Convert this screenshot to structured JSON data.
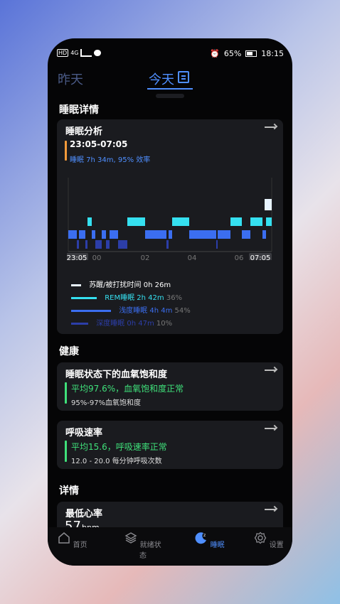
{
  "status": {
    "network": "4G",
    "battery": "65%",
    "time": "18:15",
    "hd": "HD"
  },
  "topnav": {
    "yesterday": "昨天",
    "today": "今天"
  },
  "sections": {
    "details": "睡眠详情",
    "health": "健康",
    "more": "详情"
  },
  "sleep_card": {
    "title": "睡眠分析",
    "range": "23:05-07:05",
    "summary": "睡眠 7h 34m, 95% 效率",
    "x_labels": [
      "23:05",
      "00",
      "02",
      "04",
      "06",
      "07:05"
    ]
  },
  "legend": [
    {
      "label": "苏醒/被打扰时间",
      "value": "0h 26m",
      "pct": "",
      "color": "#e8f4ff"
    },
    {
      "label": "REM睡眠",
      "value": "2h 42m",
      "pct": "36%",
      "color": "#35e0f0"
    },
    {
      "label": "浅度睡眠",
      "value": "4h 4m",
      "pct": "54%",
      "color": "#3b6ef0"
    },
    {
      "label": "深度睡眠",
      "value": "0h 47m",
      "pct": "10%",
      "color": "#2c3ea8"
    }
  ],
  "spo2_card": {
    "title": "睡眠状态下的血氧饱和度",
    "status": "平均97.6%，血氧饱和度正常",
    "range": "95%-97%血氧饱和度"
  },
  "resp_card": {
    "title": "呼吸速率",
    "status": "平均15.6，呼吸速率正常",
    "range": "12.0 - 20.0 每分钟呼吸次数"
  },
  "hr_card": {
    "title": "最低心率",
    "value": "57",
    "unit": "bpm"
  },
  "bottomnav": [
    {
      "label": "首页",
      "icon": "home-icon"
    },
    {
      "label": "就绪状态",
      "icon": "layers-icon"
    },
    {
      "label": "睡眠",
      "icon": "moon-icon"
    },
    {
      "label": "设置",
      "icon": "gear-icon"
    }
  ],
  "colors": {
    "accent": "#4f8fff",
    "green": "#3fe07a",
    "orange": "#f59a3a"
  }
}
